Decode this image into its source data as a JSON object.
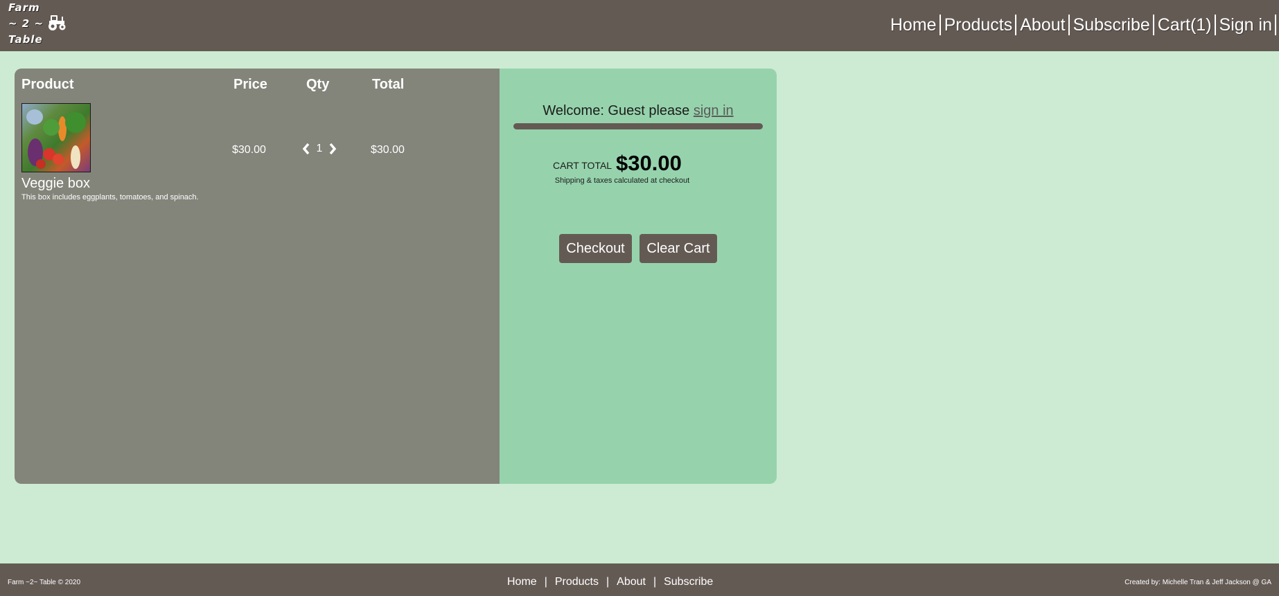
{
  "header": {
    "logo": {
      "line1": "Farm",
      "line2": "~ 2 ~",
      "line3": "Table",
      "icon": "tractor-icon"
    },
    "nav": [
      "Home",
      "Products",
      "About",
      "Subscribe",
      "Cart(1)",
      "Sign in"
    ]
  },
  "cart": {
    "columns": {
      "product": "Product",
      "price": "Price",
      "qty": "Qty",
      "total": "Total"
    },
    "items": [
      {
        "name": "Veggie box",
        "description": "This box includes eggplants, tomatoes, and spinach.",
        "price": "$30.00",
        "qty": "1",
        "total": "$30.00",
        "image": "veggie-box-photo"
      }
    ]
  },
  "summary": {
    "welcome_prefix": "Welcome: Guest please ",
    "sign_in_link": "sign in",
    "cart_total_label": "CART TOTAL",
    "cart_total_value": "$30.00",
    "shipping_note": "Shipping & taxes calculated at checkout",
    "checkout_label": "Checkout",
    "clear_label": "Clear Cart"
  },
  "footer": {
    "copyright": "Farm ~2~ Table © 2020",
    "nav": [
      "Home",
      "Products",
      "About",
      "Subscribe"
    ],
    "separator": "|",
    "credits": "Created by: Michelle Tran & Jeff Jackson @ GA"
  },
  "colors": {
    "background": "#cdebd2",
    "header": "#645a54",
    "cart_panel": "#83857a",
    "summary_panel": "#96d3ac",
    "button": "#645a54"
  }
}
